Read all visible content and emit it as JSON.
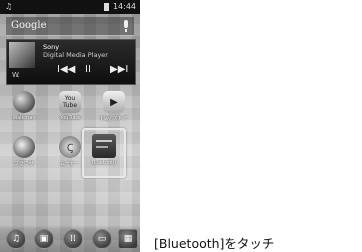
{
  "status_bar": {
    "time": "14:44",
    "left_icon": "music-note-icon",
    "battery_icon": "battery-icon"
  },
  "search_widget": {
    "label": "Google",
    "mic_icon": "microphone-icon"
  },
  "music_player": {
    "artist": "Sony",
    "album": "Digital Media Player",
    "logo_text": "W.",
    "prev_symbol": "I◀◀",
    "pause_symbol": "II",
    "next_symbol": "▶▶I"
  },
  "apps_row1": [
    {
      "label": "Walkman"
    },
    {
      "label": "YouTube",
      "icon_text": "You Tube"
    },
    {
      "label": "Play ストア",
      "icon_text": "▶"
    }
  ],
  "apps_row2": [
    {
      "label": "ブラウザ"
    },
    {
      "label": "ムービー",
      "icon_text": "Ꞔ"
    },
    {
      "label": "Bluetooth"
    }
  ],
  "dock_icons": [
    "music-icon",
    "film-icon",
    "apps-grid-icon",
    "gallery-icon",
    "settings-icon"
  ],
  "caption": "[Bluetooth]をタッチ"
}
